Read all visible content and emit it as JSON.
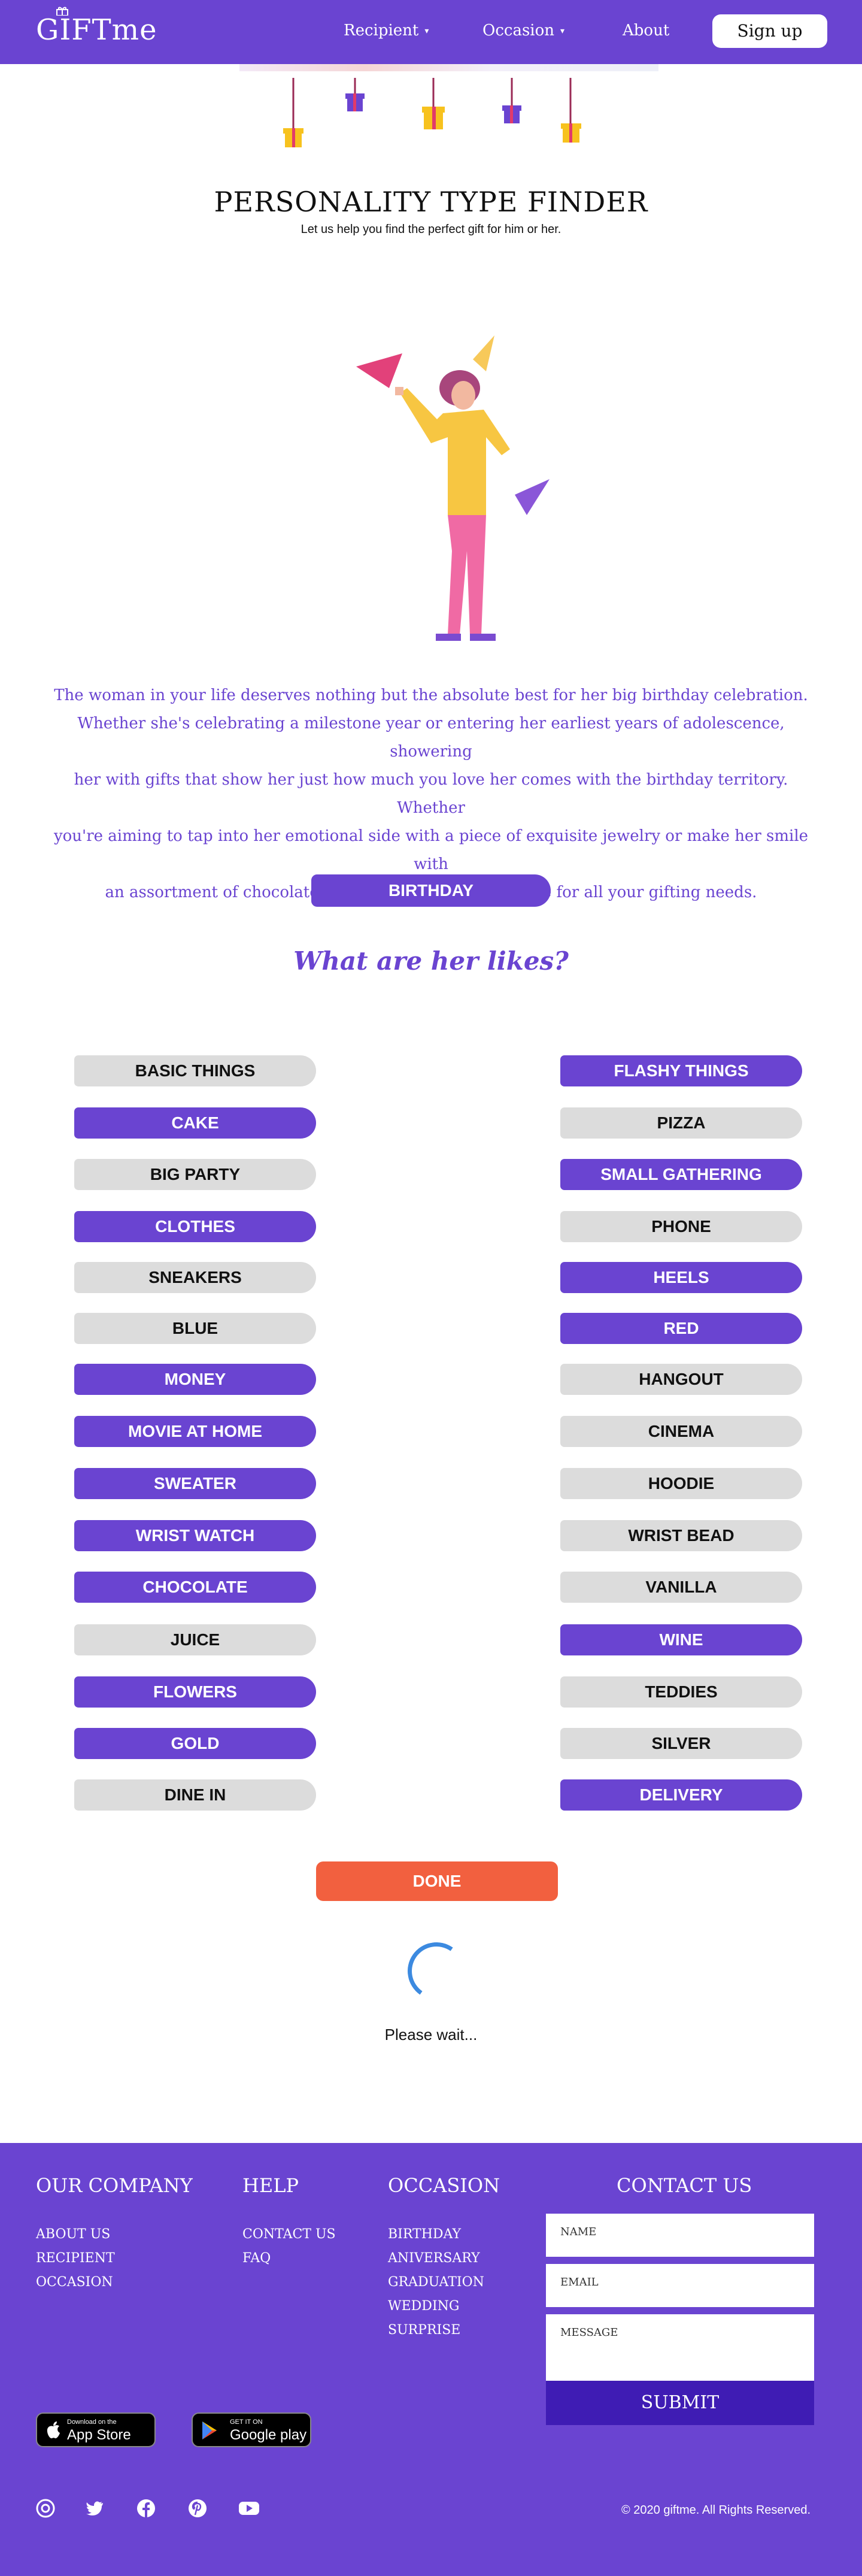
{
  "nav": {
    "logo": "GIFTme",
    "recipient": "Recipient",
    "occasion": "Occasion",
    "about": "About",
    "signup": "Sign up"
  },
  "finder": {
    "title": "PERSONALITY TYPE FINDER",
    "subtitle": "Let us help you find the perfect gift for him or her.",
    "intro_lines": [
      "The woman in your life deserves nothing but the absolute best for her big birthday celebration.",
      "Whether she's celebrating a milestone year or entering her earliest years of adolescence, showering",
      "her with gifts that show her just how much you love her comes with the birthday territory. Whether",
      "you're aiming to tap into her emotional side with a piece of exquisite jewelry or make her smile with",
      "an assortment of chocolates, Giftme is your go-to source for all your gifting needs."
    ],
    "occasion": "BIRTHDAY",
    "likes_heading": "What are her likes?",
    "options": [
      {
        "left": "BASIC THINGS",
        "left_on": false,
        "right": "FLASHY THINGS",
        "right_on": true
      },
      {
        "left": "CAKE",
        "left_on": true,
        "right": "PIZZA",
        "right_on": false
      },
      {
        "left": "BIG PARTY",
        "left_on": false,
        "right": "SMALL GATHERING",
        "right_on": true
      },
      {
        "left": "CLOTHES",
        "left_on": true,
        "right": "PHONE",
        "right_on": false
      },
      {
        "left": "SNEAKERS",
        "left_on": false,
        "right": "HEELS",
        "right_on": true
      },
      {
        "left": "BLUE",
        "left_on": false,
        "right": "RED",
        "right_on": true
      },
      {
        "left": "MONEY",
        "left_on": true,
        "right": "HANGOUT",
        "right_on": false
      },
      {
        "left": "MOVIE AT HOME",
        "left_on": true,
        "right": "CINEMA",
        "right_on": false
      },
      {
        "left": "SWEATER",
        "left_on": true,
        "right": "HOODIE",
        "right_on": false
      },
      {
        "left": "WRIST WATCH",
        "left_on": true,
        "right": "WRIST BEAD",
        "right_on": false
      },
      {
        "left": "CHOCOLATE",
        "left_on": true,
        "right": "VANILLA",
        "right_on": false
      },
      {
        "left": "JUICE",
        "left_on": false,
        "right": "WINE",
        "right_on": true
      },
      {
        "left": "FLOWERS",
        "left_on": true,
        "right": "TEDDIES",
        "right_on": false
      },
      {
        "left": "GOLD",
        "left_on": true,
        "right": "SILVER",
        "right_on": false
      },
      {
        "left": "DINE IN",
        "left_on": false,
        "right": "DELIVERY",
        "right_on": true
      }
    ],
    "done": "DONE",
    "wait": "Please wait..."
  },
  "footer": {
    "company_heading": "OUR COMPANY",
    "company_links": [
      "ABOUT US",
      "RECIPIENT",
      "OCCASION"
    ],
    "help_heading": "HELP",
    "help_links": [
      "CONTACT US",
      "FAQ"
    ],
    "occasion_heading": "OCCASION",
    "occasion_links": [
      "BIRTHDAY",
      "ANIVERSARY",
      "GRADUATION",
      "WEDDING",
      "SURPRISE"
    ],
    "contact_heading": "CONTACT US",
    "name_placeholder": "NAME",
    "email_placeholder": "EMAIL",
    "message_placeholder": "MESSAGE",
    "submit": "SUBMIT",
    "appstore_small": "Download on the",
    "appstore_big": "App Store",
    "googleplay_small": "GET IT ON",
    "googleplay_big": "Google play",
    "copyright": "© 2020 giftme.  All Rights Reserved."
  },
  "colors": {
    "brand": "#6a44d1",
    "selected": "#6a44d1",
    "unselected": "#dcdcdc",
    "done": "#f2603f",
    "submit": "#3f1cb4"
  },
  "icons": [
    "instagram-icon",
    "twitter-icon",
    "facebook-icon",
    "pinterest-icon",
    "youtube-icon",
    "apple-icon",
    "google-play-icon"
  ]
}
